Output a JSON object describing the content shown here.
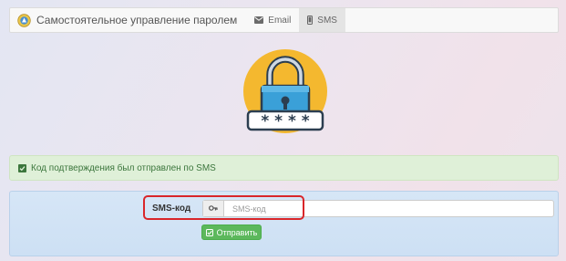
{
  "navbar": {
    "brand_title": "Самостоятельное управление паролем",
    "brand_logo_icon": "emblem-icon",
    "tabs": [
      {
        "label": "Email",
        "icon": "envelope-icon",
        "active": false
      },
      {
        "label": "SMS",
        "icon": "mobile-phone-icon",
        "active": true
      }
    ]
  },
  "illustration": {
    "icon": "padlock-icon",
    "password_mask": "* * * *",
    "colors": {
      "circle": "#f4b82f",
      "lock_body": "#3aa0d8",
      "shackle": "#2c3e50"
    }
  },
  "alert": {
    "icon": "check-square-icon",
    "message": "Код подтверждения был отправлен по SMS",
    "colors": {
      "background": "#dff0d8",
      "text": "#3c763d"
    }
  },
  "form": {
    "label": "SMS-код",
    "input_icon": "key-icon",
    "input_placeholder": "SMS-код",
    "input_value": "",
    "submit_label": "Отправить",
    "submit_icon": "check-square-icon",
    "colors": {
      "submit": "#5cb85c",
      "highlight_border": "#d9262a"
    }
  }
}
